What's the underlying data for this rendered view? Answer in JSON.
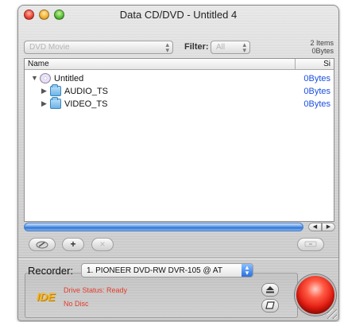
{
  "window": {
    "title": "Data CD/DVD - Untitled 4"
  },
  "toolbar": {
    "source_value": "DVD Movie",
    "filter_label": "Filter:",
    "filter_value": "All",
    "summary_items": "2 Items",
    "summary_size": "0Bytes"
  },
  "list": {
    "columns": {
      "name": "Name",
      "size": "Si"
    },
    "rows": [
      {
        "name": "Untitled",
        "size": "0Bytes",
        "icon": "disc-icon",
        "expanded": true,
        "level": 0
      },
      {
        "name": "AUDIO_TS",
        "size": "0Bytes",
        "icon": "folder-icon",
        "expanded": false,
        "level": 1
      },
      {
        "name": "VIDEO_TS",
        "size": "0Bytes",
        "icon": "folder-icon",
        "expanded": false,
        "level": 1
      }
    ]
  },
  "actions": {
    "add_symbol": "+",
    "remove_symbol": "×"
  },
  "recorder": {
    "label": "Recorder:",
    "value": "1. PIONEER DVD-RW  DVR-105 @ AT",
    "interface_logo": "IDE",
    "drive_status": "Drive Status: Ready",
    "disc_status": "No Disc"
  },
  "colors": {
    "status_text": "#e23a2a",
    "size_text": "#1a4fe0",
    "burn_button": "#e11b10",
    "scroll_accent": "#2f73d6"
  }
}
